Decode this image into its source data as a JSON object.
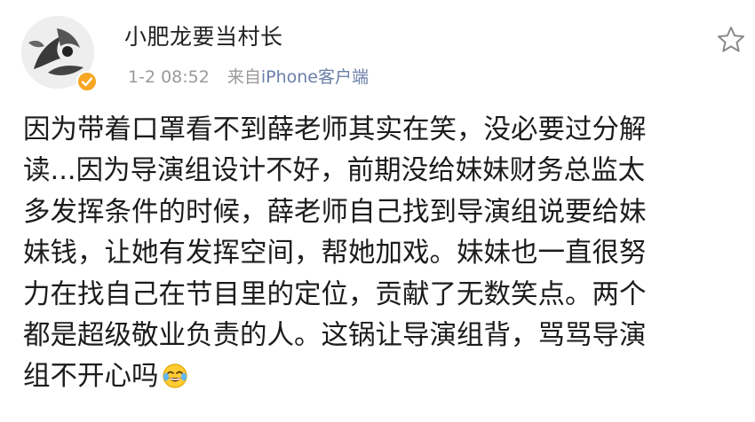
{
  "post": {
    "author": {
      "username": "小肥龙要当村长",
      "avatar_icon": "avatar-image",
      "verified_icon": "verified-badge-icon",
      "verified_color": "#f6a623"
    },
    "meta": {
      "time": "1-2 08:52",
      "source_prefix": "来自",
      "source_device": "iPhone客户端"
    },
    "favorite_icon": "star-outline-icon",
    "body_lines": [
      "因为带着口罩看不到薛老师其实在笑，没必要过分解",
      "读...因为导演组设计不好，前期没给妹妹财务总监太",
      "多发挥条件的时候，薛老师自己找到导演组说要给妹",
      "妹钱，让她有发挥空间，帮她加戏。妹妹也一直很努",
      "力在找自己在节目里的定位，贡献了无数笑点。两个",
      "都是超级敬业负责的人。这锅让导演组背，骂骂导演",
      "组不开心吗"
    ],
    "trailing_emoji": "laughing-crying-emoji-icon"
  }
}
